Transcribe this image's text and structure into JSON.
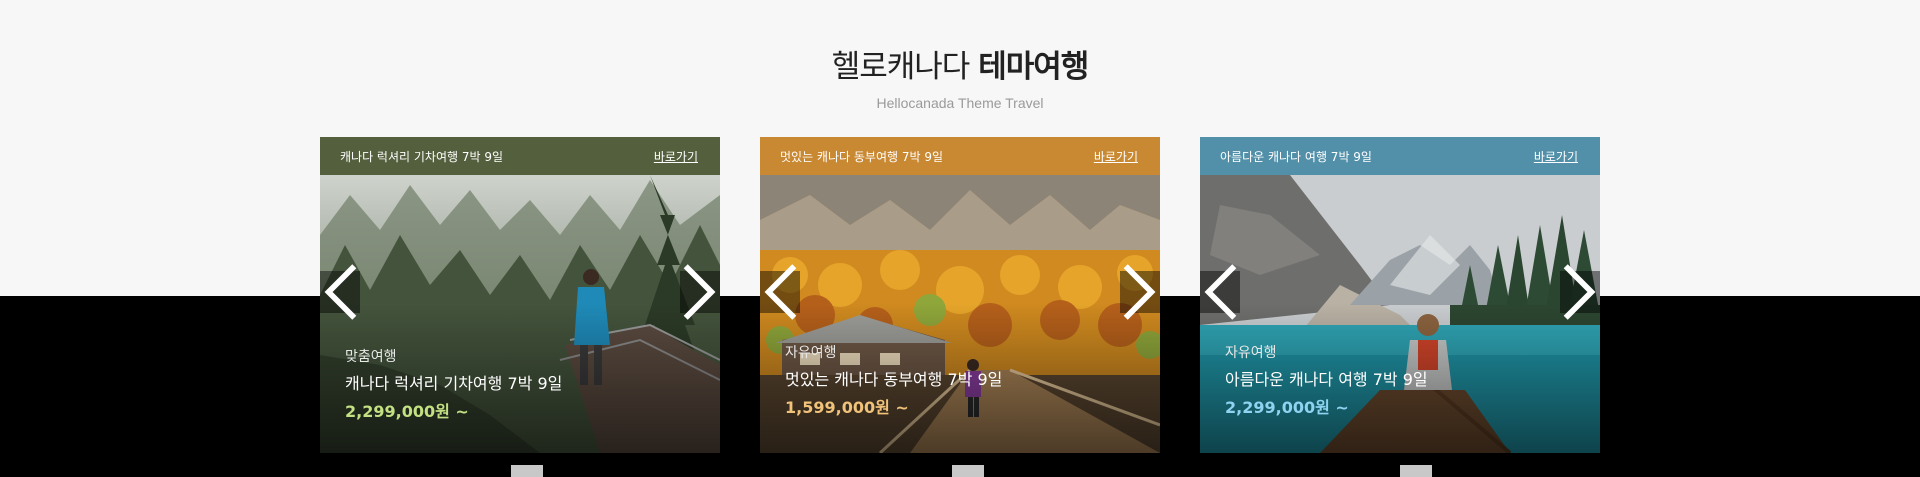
{
  "section": {
    "title_light": "헬로캐나다",
    "title_bold": "테마여행",
    "subtitle": "Hellocanada Theme Travel"
  },
  "cards": [
    {
      "header_title": "캐나다 럭셔리 기차여행 7박 9일",
      "link_label": "바로가기",
      "category": "맞춤여행",
      "name": "캐나다 럭셔리 기차여행 7박 9일",
      "price": "2,299,000원 ~",
      "header_color": "#545f3d",
      "price_color": "#c3e082",
      "photo": "misty-forest-hiker"
    },
    {
      "header_title": "멋있는 캐나다 동부여행 7박 9일",
      "link_label": "바로가기",
      "category": "자유여행",
      "name": "멋있는 캐나다 동부여행 7박 9일",
      "price": "1,599,000원 ~",
      "header_color": "#c98832",
      "price_color": "#f0c27a",
      "photo": "autumn-lodge-bridge"
    },
    {
      "header_title": "아름다운 캐나다 여행 7박 9일",
      "link_label": "바로가기",
      "category": "자유여행",
      "name": "아름다운 캐나다 여행 7박 9일",
      "price": "2,299,000원 ~",
      "header_color": "#5190a8",
      "price_color": "#8fd3f0",
      "photo": "lake-canoe"
    }
  ],
  "icons": {
    "prev": "chevron-left-icon",
    "next": "chevron-right-icon"
  }
}
